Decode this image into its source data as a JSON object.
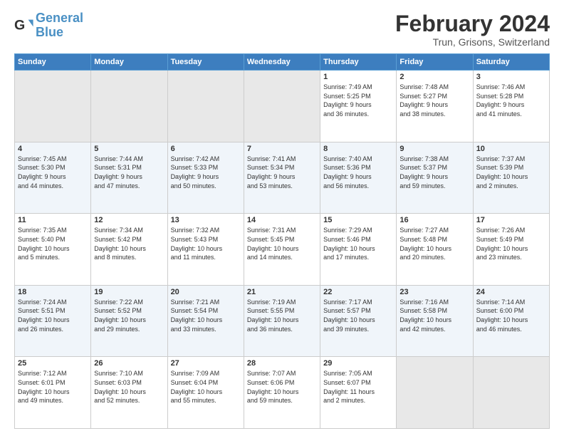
{
  "header": {
    "logo_line1": "General",
    "logo_line2": "Blue",
    "month": "February 2024",
    "location": "Trun, Grisons, Switzerland"
  },
  "weekdays": [
    "Sunday",
    "Monday",
    "Tuesday",
    "Wednesday",
    "Thursday",
    "Friday",
    "Saturday"
  ],
  "weeks": [
    [
      {
        "day": "",
        "info": ""
      },
      {
        "day": "",
        "info": ""
      },
      {
        "day": "",
        "info": ""
      },
      {
        "day": "",
        "info": ""
      },
      {
        "day": "1",
        "info": "Sunrise: 7:49 AM\nSunset: 5:25 PM\nDaylight: 9 hours\nand 36 minutes."
      },
      {
        "day": "2",
        "info": "Sunrise: 7:48 AM\nSunset: 5:27 PM\nDaylight: 9 hours\nand 38 minutes."
      },
      {
        "day": "3",
        "info": "Sunrise: 7:46 AM\nSunset: 5:28 PM\nDaylight: 9 hours\nand 41 minutes."
      }
    ],
    [
      {
        "day": "4",
        "info": "Sunrise: 7:45 AM\nSunset: 5:30 PM\nDaylight: 9 hours\nand 44 minutes."
      },
      {
        "day": "5",
        "info": "Sunrise: 7:44 AM\nSunset: 5:31 PM\nDaylight: 9 hours\nand 47 minutes."
      },
      {
        "day": "6",
        "info": "Sunrise: 7:42 AM\nSunset: 5:33 PM\nDaylight: 9 hours\nand 50 minutes."
      },
      {
        "day": "7",
        "info": "Sunrise: 7:41 AM\nSunset: 5:34 PM\nDaylight: 9 hours\nand 53 minutes."
      },
      {
        "day": "8",
        "info": "Sunrise: 7:40 AM\nSunset: 5:36 PM\nDaylight: 9 hours\nand 56 minutes."
      },
      {
        "day": "9",
        "info": "Sunrise: 7:38 AM\nSunset: 5:37 PM\nDaylight: 9 hours\nand 59 minutes."
      },
      {
        "day": "10",
        "info": "Sunrise: 7:37 AM\nSunset: 5:39 PM\nDaylight: 10 hours\nand 2 minutes."
      }
    ],
    [
      {
        "day": "11",
        "info": "Sunrise: 7:35 AM\nSunset: 5:40 PM\nDaylight: 10 hours\nand 5 minutes."
      },
      {
        "day": "12",
        "info": "Sunrise: 7:34 AM\nSunset: 5:42 PM\nDaylight: 10 hours\nand 8 minutes."
      },
      {
        "day": "13",
        "info": "Sunrise: 7:32 AM\nSunset: 5:43 PM\nDaylight: 10 hours\nand 11 minutes."
      },
      {
        "day": "14",
        "info": "Sunrise: 7:31 AM\nSunset: 5:45 PM\nDaylight: 10 hours\nand 14 minutes."
      },
      {
        "day": "15",
        "info": "Sunrise: 7:29 AM\nSunset: 5:46 PM\nDaylight: 10 hours\nand 17 minutes."
      },
      {
        "day": "16",
        "info": "Sunrise: 7:27 AM\nSunset: 5:48 PM\nDaylight: 10 hours\nand 20 minutes."
      },
      {
        "day": "17",
        "info": "Sunrise: 7:26 AM\nSunset: 5:49 PM\nDaylight: 10 hours\nand 23 minutes."
      }
    ],
    [
      {
        "day": "18",
        "info": "Sunrise: 7:24 AM\nSunset: 5:51 PM\nDaylight: 10 hours\nand 26 minutes."
      },
      {
        "day": "19",
        "info": "Sunrise: 7:22 AM\nSunset: 5:52 PM\nDaylight: 10 hours\nand 29 minutes."
      },
      {
        "day": "20",
        "info": "Sunrise: 7:21 AM\nSunset: 5:54 PM\nDaylight: 10 hours\nand 33 minutes."
      },
      {
        "day": "21",
        "info": "Sunrise: 7:19 AM\nSunset: 5:55 PM\nDaylight: 10 hours\nand 36 minutes."
      },
      {
        "day": "22",
        "info": "Sunrise: 7:17 AM\nSunset: 5:57 PM\nDaylight: 10 hours\nand 39 minutes."
      },
      {
        "day": "23",
        "info": "Sunrise: 7:16 AM\nSunset: 5:58 PM\nDaylight: 10 hours\nand 42 minutes."
      },
      {
        "day": "24",
        "info": "Sunrise: 7:14 AM\nSunset: 6:00 PM\nDaylight: 10 hours\nand 46 minutes."
      }
    ],
    [
      {
        "day": "25",
        "info": "Sunrise: 7:12 AM\nSunset: 6:01 PM\nDaylight: 10 hours\nand 49 minutes."
      },
      {
        "day": "26",
        "info": "Sunrise: 7:10 AM\nSunset: 6:03 PM\nDaylight: 10 hours\nand 52 minutes."
      },
      {
        "day": "27",
        "info": "Sunrise: 7:09 AM\nSunset: 6:04 PM\nDaylight: 10 hours\nand 55 minutes."
      },
      {
        "day": "28",
        "info": "Sunrise: 7:07 AM\nSunset: 6:06 PM\nDaylight: 10 hours\nand 59 minutes."
      },
      {
        "day": "29",
        "info": "Sunrise: 7:05 AM\nSunset: 6:07 PM\nDaylight: 11 hours\nand 2 minutes."
      },
      {
        "day": "",
        "info": ""
      },
      {
        "day": "",
        "info": ""
      }
    ]
  ]
}
